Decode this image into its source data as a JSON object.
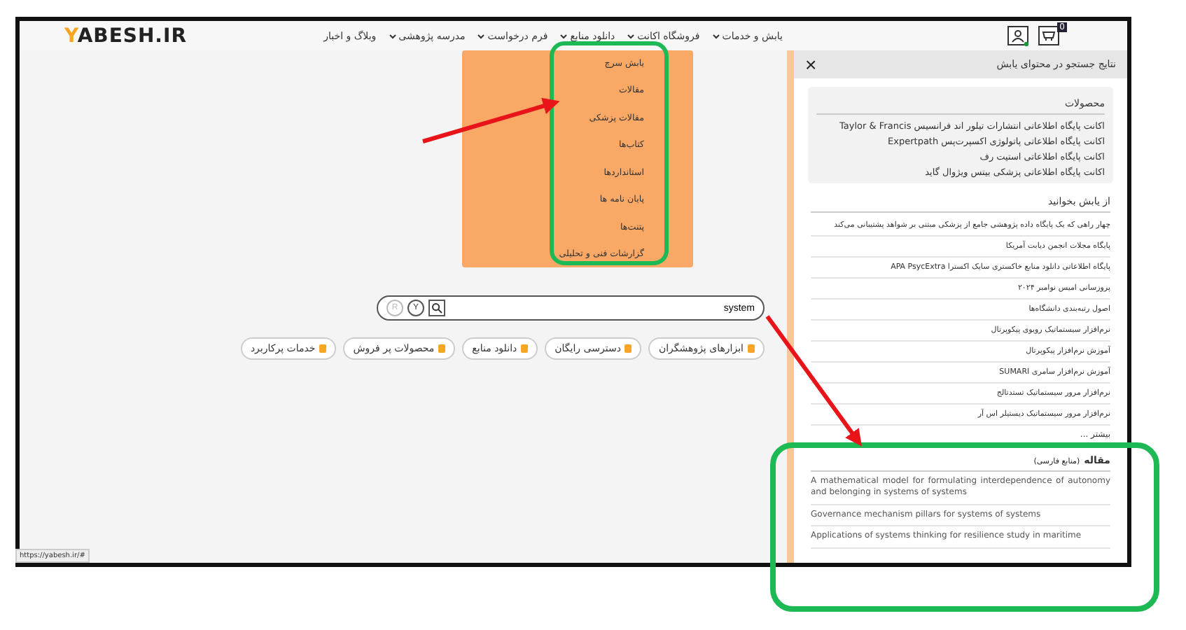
{
  "header": {
    "logo": {
      "accent": "Y",
      "rest": "ABESH.IR"
    },
    "nav": [
      {
        "label": "یابش و خدمات",
        "has_menu": true
      },
      {
        "label": "فروشگاه اکانت",
        "has_menu": true
      },
      {
        "label": "دانلود منابع",
        "has_menu": true
      },
      {
        "label": "فرم درخواست",
        "has_menu": true
      },
      {
        "label": "مدرسه پژوهشی",
        "has_menu": true
      },
      {
        "label": "وبلاگ و اخبار",
        "has_menu": false
      }
    ],
    "cart_badge": "0"
  },
  "dropdown": {
    "items": [
      "یابش سرچ",
      "مقالات",
      "مقالات پزشکی",
      "کتاب‌ها",
      "استانداردها",
      "پایان نامه ها",
      "پتنت‌ها",
      "گزارشات فنی و تحلیلی"
    ]
  },
  "search": {
    "value": "system",
    "buttons": [
      "Y",
      "R"
    ]
  },
  "chips": [
    "ابزارهای پژوهشگران",
    "دسترسی رایگان",
    "دانلود منابع",
    "محصولات پر فروش",
    "خدمات پرکاربرد"
  ],
  "panel": {
    "title": "نتایج جستجو در محتوای یابش",
    "close": "×",
    "products": {
      "heading": "محصولات",
      "items": [
        "اکانت پایگاه اطلاعاتی انتشارات تیلور اند فرانسیس Taylor & Francis",
        "اکانت پایگاه اطلاعاتی پاتولوژی اکسپرت‌پس Expertpath",
        "اکانت پایگاه اطلاعاتی استیت رف",
        "اکانت پایگاه اطلاعاتی پزشکی بیتس ویژوال گاید"
      ]
    },
    "read": {
      "heading": "از یابش بخوانید",
      "items": [
        "چهار راهی که یک پایگاه داده پژوهشی جامع از پزشکی مبتنی بر شواهد پشتیبانی می‌کند",
        "پایگاه مجلات انجمن دیابت آمریکا",
        "پایگاه اطلاعاتی دانلود منابع خاکستری سایک اکسترا APA PsycExtra",
        "پروزسانی امیس نوامبر ۲۰۲۴",
        "اصول رتبه‌بندی دانشگاه‌ها",
        "نرم‌افزار سیستماتیک رویوی پیکوپرتال",
        "آموزش نرم‌افزار پیکوپرتال",
        "آموزش نرم‌افزار سامری SUMARI",
        "نرم‌افزار مرور سیستماتیک تستد‌تالج",
        "نرم‌افزار مرور سیستماتیک دیستیلر اس آر"
      ],
      "more": "بیشتر ..."
    },
    "articles": {
      "heading": "مقاله",
      "note": "(منابع فارسی)",
      "items": [
        "A mathematical model for formulating interdependence of autonomy and belonging in systems of systems",
        "Governance mechanism pillars for systems of systems",
        "Applications of systems thinking for resilience study in maritime"
      ]
    }
  },
  "status_url": "https://yabesh.ir/#"
}
